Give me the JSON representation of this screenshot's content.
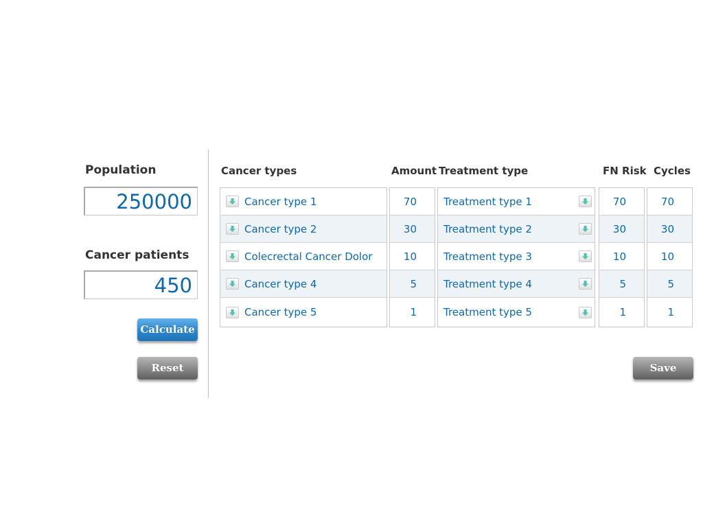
{
  "left_panel": {
    "population_label": "Population",
    "population_value": "250000",
    "patients_label": "Cancer patients",
    "patients_value": "450",
    "calculate_label": "Calculate",
    "reset_label": "Reset"
  },
  "table": {
    "headers": {
      "cancer_types": "Cancer types",
      "amount": "Amount",
      "treatment_type": "Treatment type",
      "fn_risk": "FN Risk",
      "cycles": "Cycles"
    },
    "rows": [
      {
        "cancer": "Cancer type 1",
        "amount": "70",
        "treatment": "Treatment type 1",
        "fn_risk": "70",
        "cycles": "70"
      },
      {
        "cancer": "Cancer type 2",
        "amount": "30",
        "treatment": "Treatment type 2",
        "fn_risk": "30",
        "cycles": "30"
      },
      {
        "cancer": "Colecrectal Cancer Dolor",
        "amount": "10",
        "treatment": "Treatment type 3",
        "fn_risk": "10",
        "cycles": "10"
      },
      {
        "cancer": "Cancer type 4",
        "amount": "5",
        "treatment": "Treatment type 4",
        "fn_risk": "5",
        "cycles": "5"
      },
      {
        "cancer": "Cancer type 5",
        "amount": "1",
        "treatment": "Treatment type 5",
        "fn_risk": "1",
        "cycles": "1"
      }
    ],
    "save_label": "Save"
  },
  "colors": {
    "accent_blue": "#0d68ad",
    "header_text": "#333333",
    "button_blue": "#2c86cc",
    "button_gray": "#8a8a8a",
    "arrow_teal": "#4cc3b0"
  },
  "icons": {
    "dropdown": "chevron-down-icon"
  }
}
